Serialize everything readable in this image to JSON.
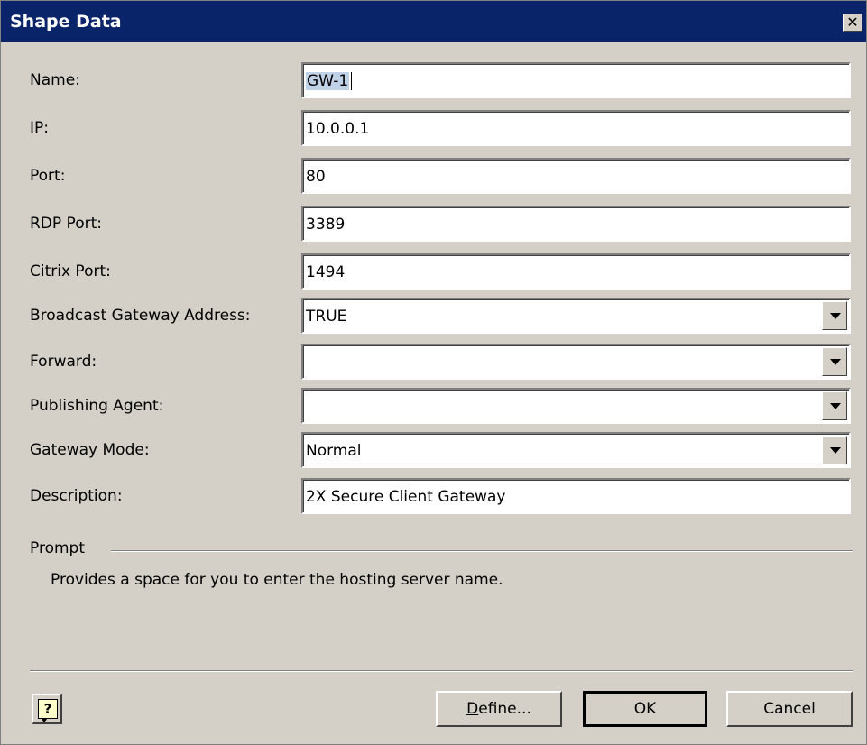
{
  "dialog": {
    "title": "Shape Data",
    "close_label": "✕"
  },
  "fields": [
    {
      "label": "Name:",
      "value": "GW-1",
      "type": "text",
      "selected": true
    },
    {
      "label": "IP:",
      "value": "10.0.0.1",
      "type": "text"
    },
    {
      "label": "Port:",
      "value": "80",
      "type": "text"
    },
    {
      "label": "RDP Port:",
      "value": "3389",
      "type": "text"
    },
    {
      "label": "Citrix Port:",
      "value": "1494",
      "type": "text"
    },
    {
      "label": "Broadcast Gateway Address:",
      "value": "TRUE",
      "type": "dropdown"
    },
    {
      "label": "Forward:",
      "value": "",
      "type": "dropdown"
    },
    {
      "label": "Publishing Agent:",
      "value": "",
      "type": "dropdown"
    },
    {
      "label": "Gateway Mode:",
      "value": "Normal",
      "type": "dropdown"
    },
    {
      "label": "Description:",
      "value": "2X Secure Client Gateway",
      "type": "text"
    }
  ],
  "prompt": {
    "heading": "Prompt",
    "text": "Provides a space for you to enter the hosting server name."
  },
  "buttons": {
    "help_icon": "help-icon",
    "define_prefix": "D",
    "define_rest": "efine...",
    "ok": "OK",
    "cancel": "Cancel"
  }
}
